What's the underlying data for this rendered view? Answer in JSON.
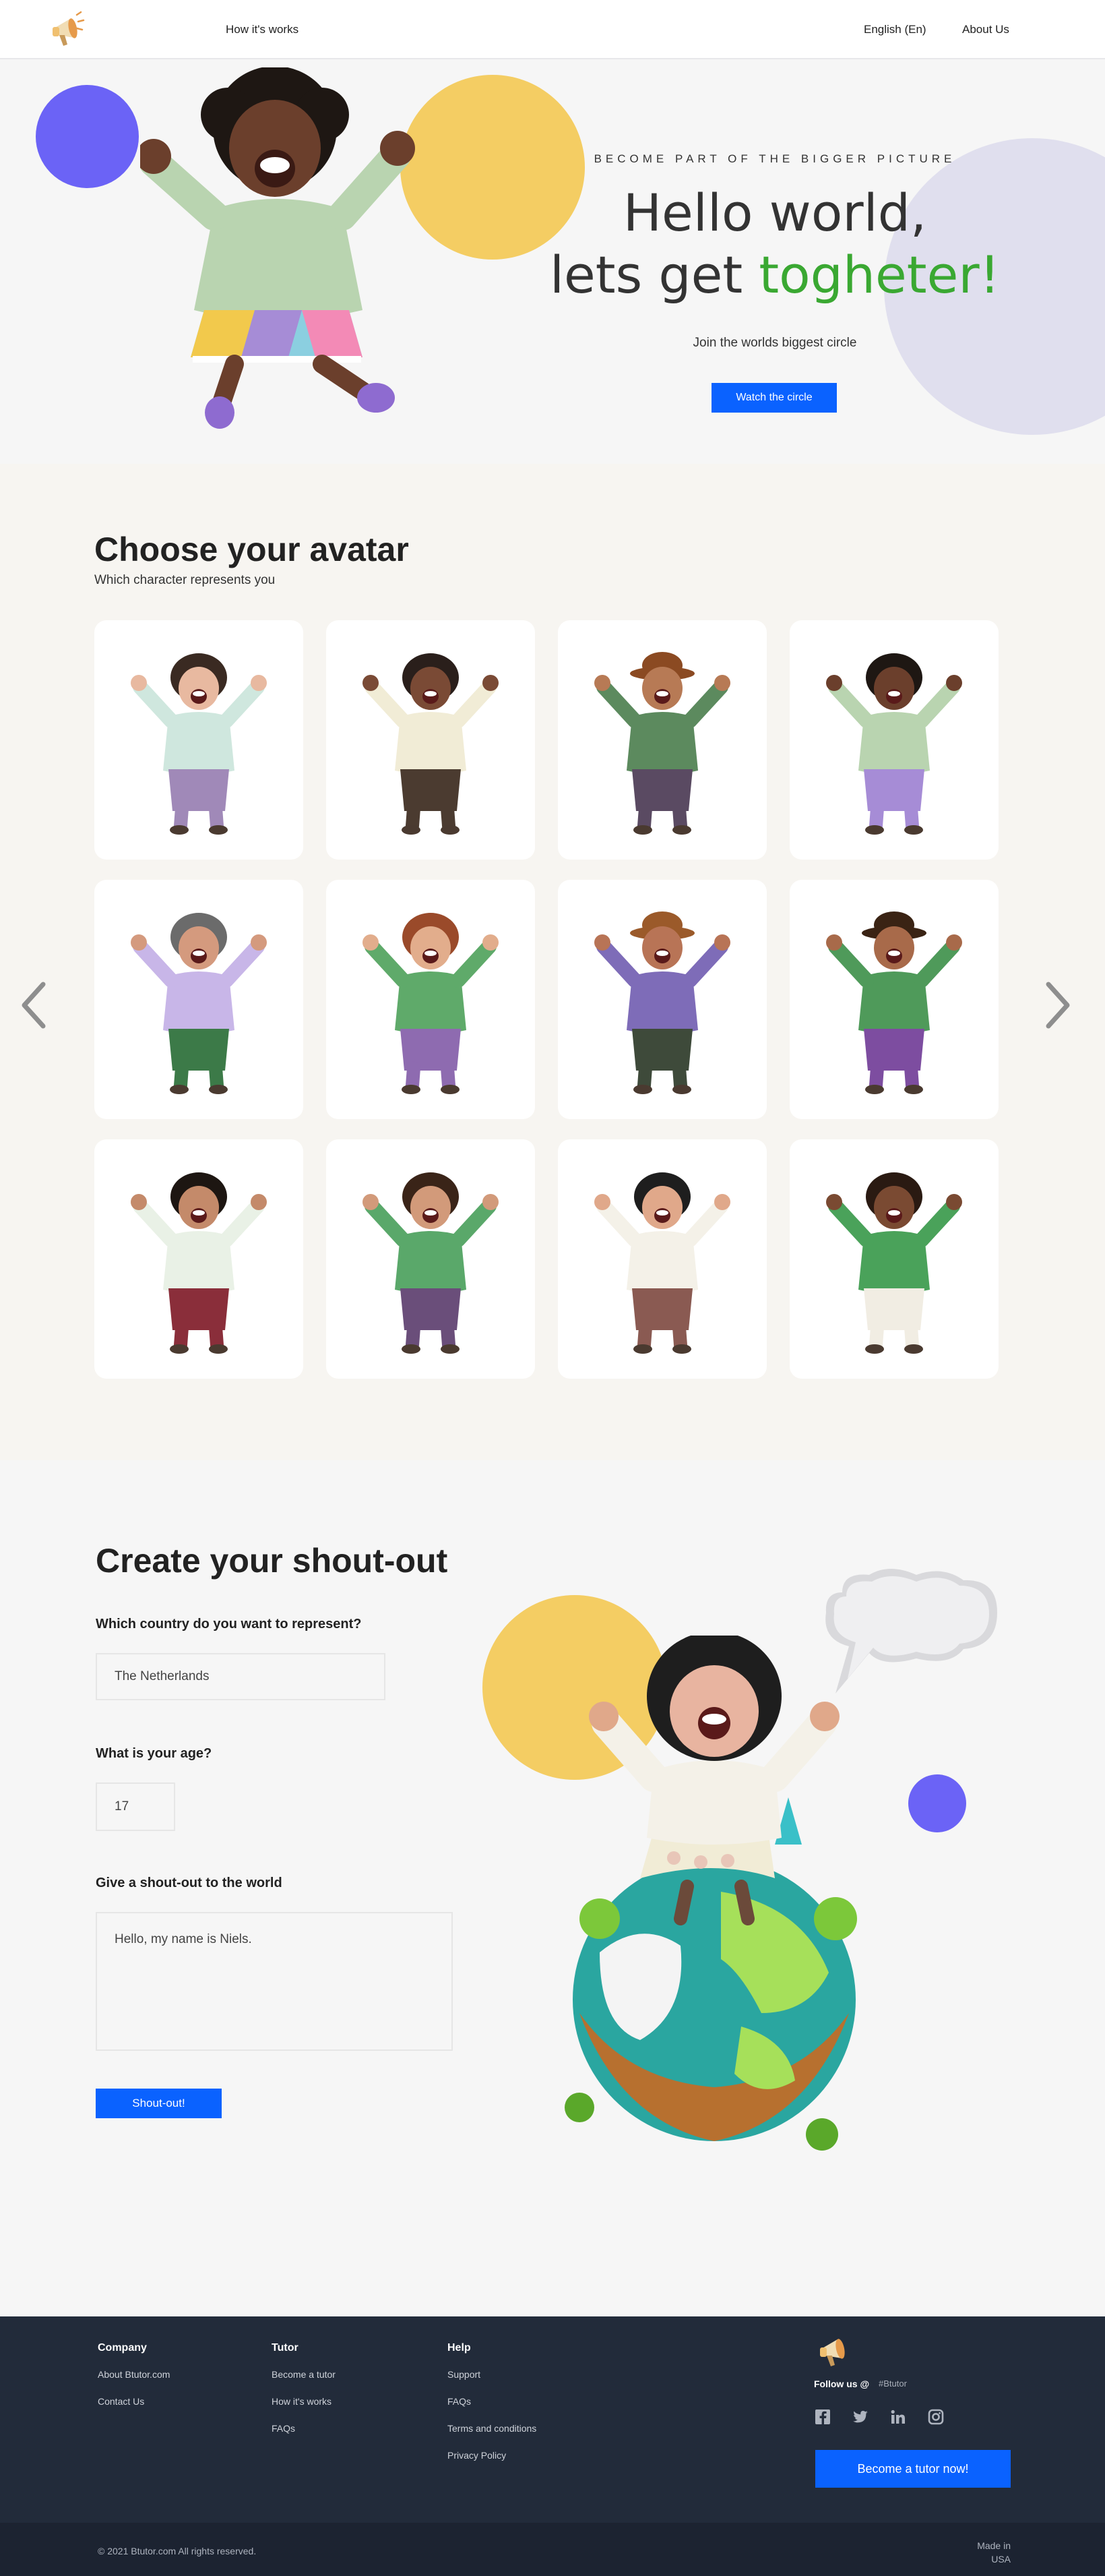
{
  "nav": {
    "how_it_works": "How it's works",
    "language": "English (En)",
    "about": "About Us",
    "logo_icon": "megaphone-icon"
  },
  "hero": {
    "eyebrow": "BECOME PART OF THE BIGGER PICTURE",
    "headline_line1": "Hello world,",
    "headline_line2_start": "lets get ",
    "headline_line2_accent": "togheter!",
    "subtitle": "Join the worlds biggest circle",
    "cta": "Watch the circle",
    "colors": {
      "accent_green": "#3aa832",
      "primary_blue": "#0a62ff",
      "circle_blue": "#6b63f6",
      "circle_yellow": "#f4cd63",
      "circle_lilac": "#e0dfee"
    }
  },
  "avatars": {
    "title": "Choose your avatar",
    "subtitle": "Which character represents you",
    "items": [
      {
        "shirt": "#cfe7de",
        "pants": "#a089b8",
        "hair": "#3a2a22",
        "skin": "#e8b9a0",
        "hat": false
      },
      {
        "shirt": "#f1ecd6",
        "pants": "#4b3b30",
        "hair": "#2a1f1b",
        "skin": "#7a4a35",
        "hat": false
      },
      {
        "shirt": "#5c8a5e",
        "pants": "#5a4a62",
        "hair": "#8b4a22",
        "skin": "#b77a55",
        "hat": true
      },
      {
        "shirt": "#b9d4b0",
        "pants": "#a68cd6",
        "hair": "#1e1713",
        "skin": "#6b3f2c",
        "hat": false
      },
      {
        "shirt": "#c8b6e8",
        "pants": "#3c7a48",
        "hair": "#6b6b6b",
        "skin": "#d49a7e",
        "hat": false
      },
      {
        "shirt": "#5faa6a",
        "pants": "#8e6bb0",
        "hair": "#9a4a2a",
        "skin": "#e2ad8c",
        "hat": false
      },
      {
        "shirt": "#7e6cb8",
        "pants": "#3e4a3a",
        "hair": "#9b5a2a",
        "skin": "#b87456",
        "hat": true
      },
      {
        "shirt": "#4f9a5a",
        "pants": "#7d4da0",
        "hair": "#3a2314",
        "skin": "#a86a4a",
        "hat": true
      },
      {
        "shirt": "#e9f1e6",
        "pants": "#8a2e3a",
        "hair": "#1d1612",
        "skin": "#c48a6a",
        "hat": false
      },
      {
        "shirt": "#5aa86a",
        "pants": "#6a4e7a",
        "hair": "#3a2418",
        "skin": "#d29a7a",
        "hat": false
      },
      {
        "shirt": "#f4f1e8",
        "pants": "#8a5a52",
        "hair": "#1e1e1e",
        "skin": "#e0a88a",
        "hat": false
      },
      {
        "shirt": "#4aa25a",
        "pants": "#f1ede3",
        "hair": "#2a1a12",
        "skin": "#7a4a32",
        "hat": false
      }
    ]
  },
  "shout": {
    "title": "Create your shout-out",
    "country_label": "Which country do you want to represent?",
    "country_value": "The Netherlands",
    "age_label": "What is your age?",
    "age_value": "17",
    "message_label": "Give a shout-out to the world",
    "message_value": "Hello, my name is Niels.",
    "submit": "Shout-out!"
  },
  "footer": {
    "company": {
      "heading": "Company",
      "links": [
        "About Btutor.com",
        "Contact Us"
      ]
    },
    "tutor": {
      "heading": "Tutor",
      "links": [
        "Become a tutor",
        "How it's works",
        "FAQs"
      ]
    },
    "help": {
      "heading": "Help",
      "links": [
        "Support",
        "FAQs",
        "Terms and conditions",
        "Privacy Policy"
      ]
    },
    "follow": "Follow us @",
    "handle": "#Btutor",
    "socials": [
      "facebook-icon",
      "twitter-icon",
      "linkedin-icon",
      "instagram-icon"
    ],
    "cta": "Become a tutor now!",
    "copyright": "© 2021 Btutor.com  All rights reserved.",
    "made_in_1": "Made in",
    "made_in_2": "USA"
  }
}
